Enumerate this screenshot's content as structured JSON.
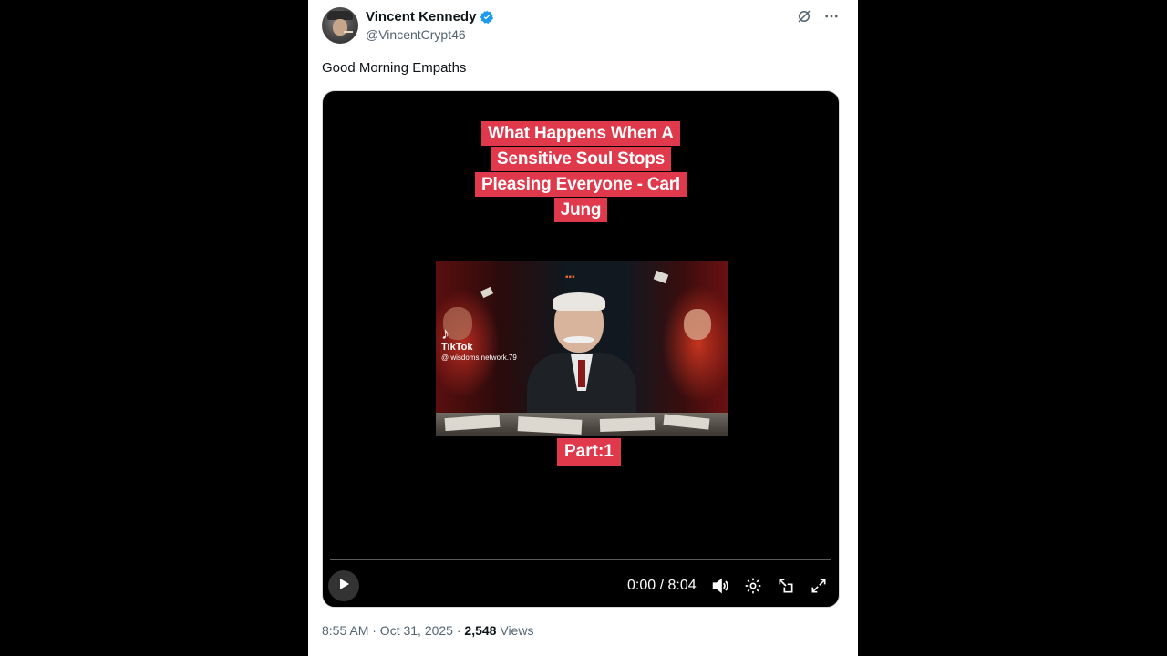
{
  "author": {
    "name": "Vincent Kennedy",
    "handle": "@VincentCrypt46"
  },
  "tweet": {
    "text": "Good Morning Empaths"
  },
  "video": {
    "caption_lines": [
      "What Happens When A",
      "Sensitive Soul Stops",
      "Pleasing Everyone - Carl",
      "Jung"
    ],
    "part_label": "Part:1",
    "watermark": {
      "brand": "TikTok",
      "handle": "@ wisdoms.network.79"
    },
    "time": "0:00 / 8:04",
    "progress": 0.0
  },
  "meta": {
    "time_date": "8:55 AM · Oct 31, 2025 · ",
    "views_count": "2,548",
    "views_label": " Views"
  },
  "colors": {
    "accent_red": "#e0394b",
    "verified_blue": "#1d9bf0",
    "text_primary": "#0f1419",
    "text_secondary": "#536471"
  },
  "icons": [
    "verified-badge-icon",
    "grok-icon",
    "more-icon",
    "play-icon",
    "volume-icon",
    "settings-icon",
    "pop-out-icon",
    "fullscreen-icon"
  ]
}
